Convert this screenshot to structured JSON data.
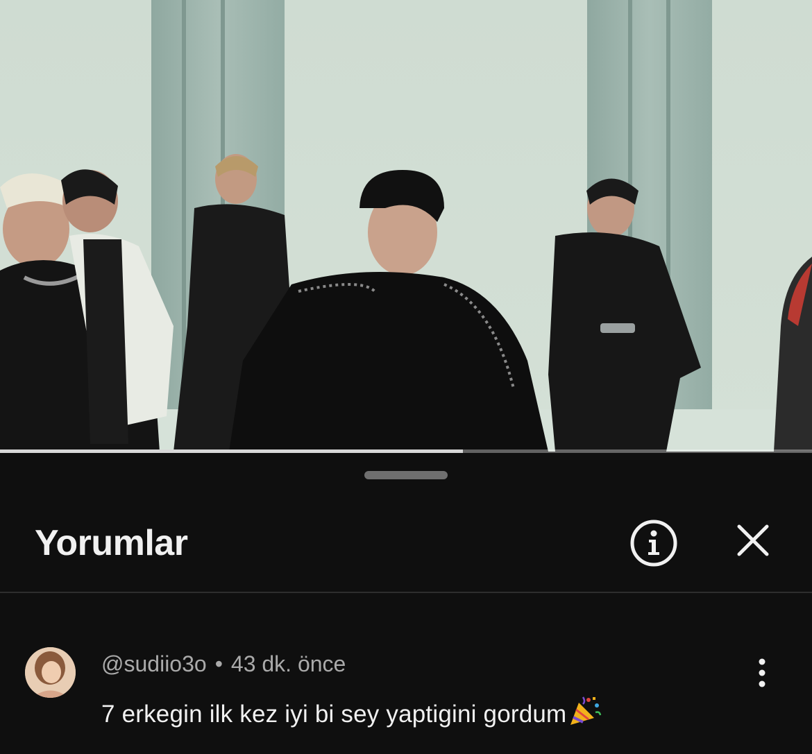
{
  "video": {
    "progress_fraction": 0.57
  },
  "comments_panel": {
    "title": "Yorumlar",
    "info_icon": "info-circle-icon",
    "close_icon": "close-icon"
  },
  "comment": {
    "username": "@sudiio3o",
    "separator": "•",
    "time_ago": "43 dk. önce",
    "text": "7 erkegin ilk kez iyi bi sey yaptigini gordum",
    "emoji_icon": "party-popper-icon",
    "more_icon": "more-vert-icon"
  },
  "colors": {
    "background": "#0f0f0f",
    "text_primary": "#f1f1f1",
    "text_secondary": "#aaaaaa"
  }
}
